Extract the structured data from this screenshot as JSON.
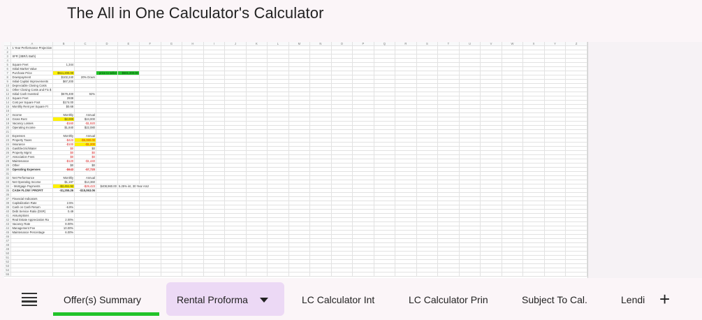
{
  "app": {
    "title": "The All in One Calculator's Calculator"
  },
  "sheet": {
    "columns": [
      "A",
      "B",
      "C",
      "D",
      "E",
      "F",
      "G",
      "H",
      "I",
      "J",
      "K",
      "L",
      "M",
      "N",
      "O",
      "P",
      "Q",
      "R",
      "S",
      "T",
      "U",
      "V",
      "W",
      "X",
      "Y",
      "Z"
    ],
    "rows": [
      {
        "n": "1",
        "a": "1 Year Performance Projection",
        "b": "",
        "c": "",
        "d": "",
        "e": "",
        "note": ""
      },
      {
        "n": "2",
        "a": "",
        "b": "",
        "c": "",
        "d": "",
        "e": "",
        "note": ""
      },
      {
        "n": "3",
        "a": "SFR (3BR/1 Bath)",
        "b": "",
        "c": "",
        "d": "",
        "e": "",
        "note": ""
      },
      {
        "n": "4",
        "a": "",
        "b": "",
        "c": "",
        "d": "",
        "e": "",
        "note": ""
      },
      {
        "n": "5",
        "a": "Square Feet",
        "b": "1,344",
        "c": "",
        "d": "",
        "e": "",
        "note": ""
      },
      {
        "n": "6",
        "a": "Initial Market Value",
        "b": "",
        "c": "",
        "d": "",
        "e": "",
        "note": ""
      },
      {
        "n": "7",
        "a": "Purchase Price",
        "b": "$511,200.00",
        "c": "",
        "d": "price to seller",
        "e": "$581,200.00",
        "note": "",
        "bYel": true,
        "deGrn": true
      },
      {
        "n": "8",
        "a": "Downpayment",
        "b": "$102,240",
        "c": "20% Down",
        "d": "",
        "e": "",
        "note": ""
      },
      {
        "n": "9",
        "a": "Initial Capital Improvements",
        "b": "$67,200",
        "c": "",
        "d": "",
        "e": "",
        "note": ""
      },
      {
        "n": "10",
        "a": "Depreciable Closing Costs",
        "b": "",
        "c": "",
        "d": "",
        "e": "",
        "note": ""
      },
      {
        "n": "11",
        "a": "Other Closing Costs and Fix $",
        "b": "",
        "c": "",
        "d": "",
        "e": "",
        "note": ""
      },
      {
        "n": "12",
        "a": "Initial Cash Invested",
        "b": "$579,400",
        "c": "92%",
        "d": "",
        "e": "",
        "note": ""
      },
      {
        "n": "13",
        "a": "Square Feet",
        "b": "2938",
        "c": "",
        "d": "",
        "e": "",
        "note": ""
      },
      {
        "n": "14",
        "a": "Cost per Square Foot",
        "b": "$174.00",
        "c": "",
        "d": "",
        "e": "",
        "note": ""
      },
      {
        "n": "15",
        "a": "Monthly Rent per Square Ft",
        "b": "$0.68",
        "c": "",
        "d": "",
        "e": "",
        "note": ""
      },
      {
        "n": "16",
        "a": "",
        "b": "",
        "c": "",
        "d": "",
        "e": "",
        "note": ""
      },
      {
        "n": "17",
        "a": "Income",
        "b": "Monthly",
        "c": "Annual",
        "d": "",
        "e": "",
        "note": ""
      },
      {
        "n": "18",
        "a": "Gross Rent",
        "b": "$2,000",
        "c": "$24,000",
        "d": "",
        "e": "",
        "note": "",
        "bYel": true
      },
      {
        "n": "19",
        "a": "Vacancy Losses",
        "b": "-$160",
        "c": "-$1,920",
        "d": "",
        "e": "",
        "note": "",
        "bRed": true,
        "cRed": true
      },
      {
        "n": "20",
        "a": "Operating Income",
        "b": "$1,840",
        "c": "$22,080",
        "d": "",
        "e": "",
        "note": ""
      },
      {
        "n": "21",
        "a": "",
        "b": "",
        "c": "",
        "d": "",
        "e": "",
        "note": ""
      },
      {
        "n": "22",
        "a": "Expenses",
        "b": "Monthly",
        "c": "Annual",
        "d": "",
        "e": "",
        "note": ""
      },
      {
        "n": "23",
        "a": "Property Taxes",
        "b": "-$423",
        "c": "-$5,080.00",
        "d": "",
        "e": "",
        "note": "",
        "bRed": true,
        "cYel": true
      },
      {
        "n": "24",
        "a": "Insurance",
        "b": "-$100",
        "c": "-$1,200",
        "d": "",
        "e": "",
        "note": "",
        "bRed": true,
        "cYel": true
      },
      {
        "n": "25",
        "a": "Gas/Electric/Water",
        "b": "$0",
        "c": "$0",
        "d": "",
        "e": "",
        "note": "",
        "bRed": true
      },
      {
        "n": "26",
        "a": "Property Mgmt",
        "b": "$0",
        "c": "$0",
        "d": "",
        "e": "",
        "note": "",
        "bRed": true,
        "cRed": true
      },
      {
        "n": "27",
        "a": "Association Fees",
        "b": "$0",
        "c": "$0",
        "d": "",
        "e": "",
        "note": "",
        "bRed": true,
        "cRed": true
      },
      {
        "n": "28",
        "a": "Maintenance",
        "b": "-$120",
        "c": "-$1,440",
        "d": "",
        "e": "",
        "note": "",
        "bRed": true,
        "cRed": true
      },
      {
        "n": "29",
        "a": "Other",
        "b": "$0",
        "c": "$0",
        "d": "",
        "e": "",
        "note": ""
      },
      {
        "n": "30",
        "a": "Operating Expenses",
        "b": "-$643",
        "c": "-$7,720",
        "d": "",
        "e": "",
        "note": "",
        "bold": true,
        "bRed": true,
        "cRed": true
      },
      {
        "n": "31",
        "a": "",
        "b": "",
        "c": "",
        "d": "",
        "e": "",
        "note": ""
      },
      {
        "n": "32",
        "a": "Net Performance",
        "b": "Monthly",
        "c": "Annual",
        "d": "",
        "e": "",
        "note": ""
      },
      {
        "n": "33",
        "a": "Net Operating Income",
        "b": "$1,197",
        "c": "$14,360",
        "d": "",
        "e": "",
        "note": ""
      },
      {
        "n": "34",
        "a": "- Mortgage Payments",
        "b": "-$2,451.92",
        "c": "-$29,423",
        "d": "$408,960.00",
        "e": "5.25% int, 30 Year Amz",
        "note": "",
        "bYel": true,
        "cRed": true
      },
      {
        "n": "35",
        "a": "CASH FLOW / PROFIT",
        "b": "-$1,255.26",
        "c": "-$15,063.06",
        "d": "",
        "e": "",
        "note": "",
        "bold": true
      },
      {
        "n": "36",
        "a": "",
        "b": "",
        "c": "",
        "d": "",
        "e": "",
        "note": ""
      },
      {
        "n": "37",
        "a": "Financial Indicators",
        "b": "",
        "c": "",
        "d": "",
        "e": "",
        "note": ""
      },
      {
        "n": "38",
        "a": "Capitalization Rate",
        "b": "2.5%",
        "c": "",
        "d": "",
        "e": "",
        "note": ""
      },
      {
        "n": "39",
        "a": "Cash on Cash Return",
        "b": "-6.9%",
        "c": "",
        "d": "",
        "e": "",
        "note": ""
      },
      {
        "n": "40",
        "a": "Debt Service Ratio (DSR)",
        "b": "0.49",
        "c": "",
        "d": "",
        "e": "",
        "note": ""
      },
      {
        "n": "41",
        "a": "Assumptions",
        "b": "",
        "c": "",
        "d": "",
        "e": "",
        "note": ""
      },
      {
        "n": "42",
        "a": "Real Estate Appreciation Ra",
        "b": "2.00%",
        "c": "",
        "d": "",
        "e": "",
        "note": ""
      },
      {
        "n": "43",
        "a": "Vacancy Rate",
        "b": "8.00%",
        "c": "",
        "d": "",
        "e": "",
        "note": ""
      },
      {
        "n": "44",
        "a": "Management Fee",
        "b": "10.00%",
        "c": "",
        "d": "",
        "e": "",
        "note": ""
      },
      {
        "n": "45",
        "a": "Maintenance Percentage",
        "b": "6.00%",
        "c": "",
        "d": "",
        "e": "",
        "note": ""
      },
      {
        "n": "46",
        "a": "",
        "b": "",
        "c": "",
        "d": "",
        "e": "",
        "note": ""
      },
      {
        "n": "47",
        "a": "",
        "b": "",
        "c": "",
        "d": "",
        "e": "",
        "note": ""
      },
      {
        "n": "48",
        "a": "",
        "b": "",
        "c": "",
        "d": "",
        "e": "",
        "note": ""
      },
      {
        "n": "49",
        "a": "",
        "b": "",
        "c": "",
        "d": "",
        "e": "",
        "note": ""
      },
      {
        "n": "50",
        "a": "",
        "b": "",
        "c": "",
        "d": "",
        "e": "",
        "note": ""
      },
      {
        "n": "51",
        "a": "",
        "b": "",
        "c": "",
        "d": "",
        "e": "",
        "note": ""
      },
      {
        "n": "52",
        "a": "",
        "b": "",
        "c": "",
        "d": "",
        "e": "",
        "note": ""
      },
      {
        "n": "53",
        "a": "",
        "b": "",
        "c": "",
        "d": "",
        "e": "",
        "note": ""
      },
      {
        "n": "54",
        "a": "",
        "b": "",
        "c": "",
        "d": "",
        "e": "",
        "note": ""
      },
      {
        "n": "55",
        "a": "",
        "b": "",
        "c": "",
        "d": "",
        "e": "",
        "note": ""
      }
    ]
  },
  "tabs": {
    "menu_icon": "hamburger-menu-icon",
    "items": [
      {
        "label": "Offer(s) Summary"
      },
      {
        "label": "Rental Proforma"
      },
      {
        "label": "LC Calculator Int"
      },
      {
        "label": "LC Calculator Prin"
      },
      {
        "label": "Subject To Cal."
      },
      {
        "label": "Lendi"
      }
    ],
    "active_index": 1,
    "underline_color": "#22c32a",
    "active_bg": "#ecd9f5",
    "add_icon": "plus-icon",
    "dropdown_icon": "caret-down-icon"
  },
  "colors": {
    "highlight_yellow": "#fff200",
    "highlight_green": "#22c32a",
    "negative_red": "#d62020"
  }
}
